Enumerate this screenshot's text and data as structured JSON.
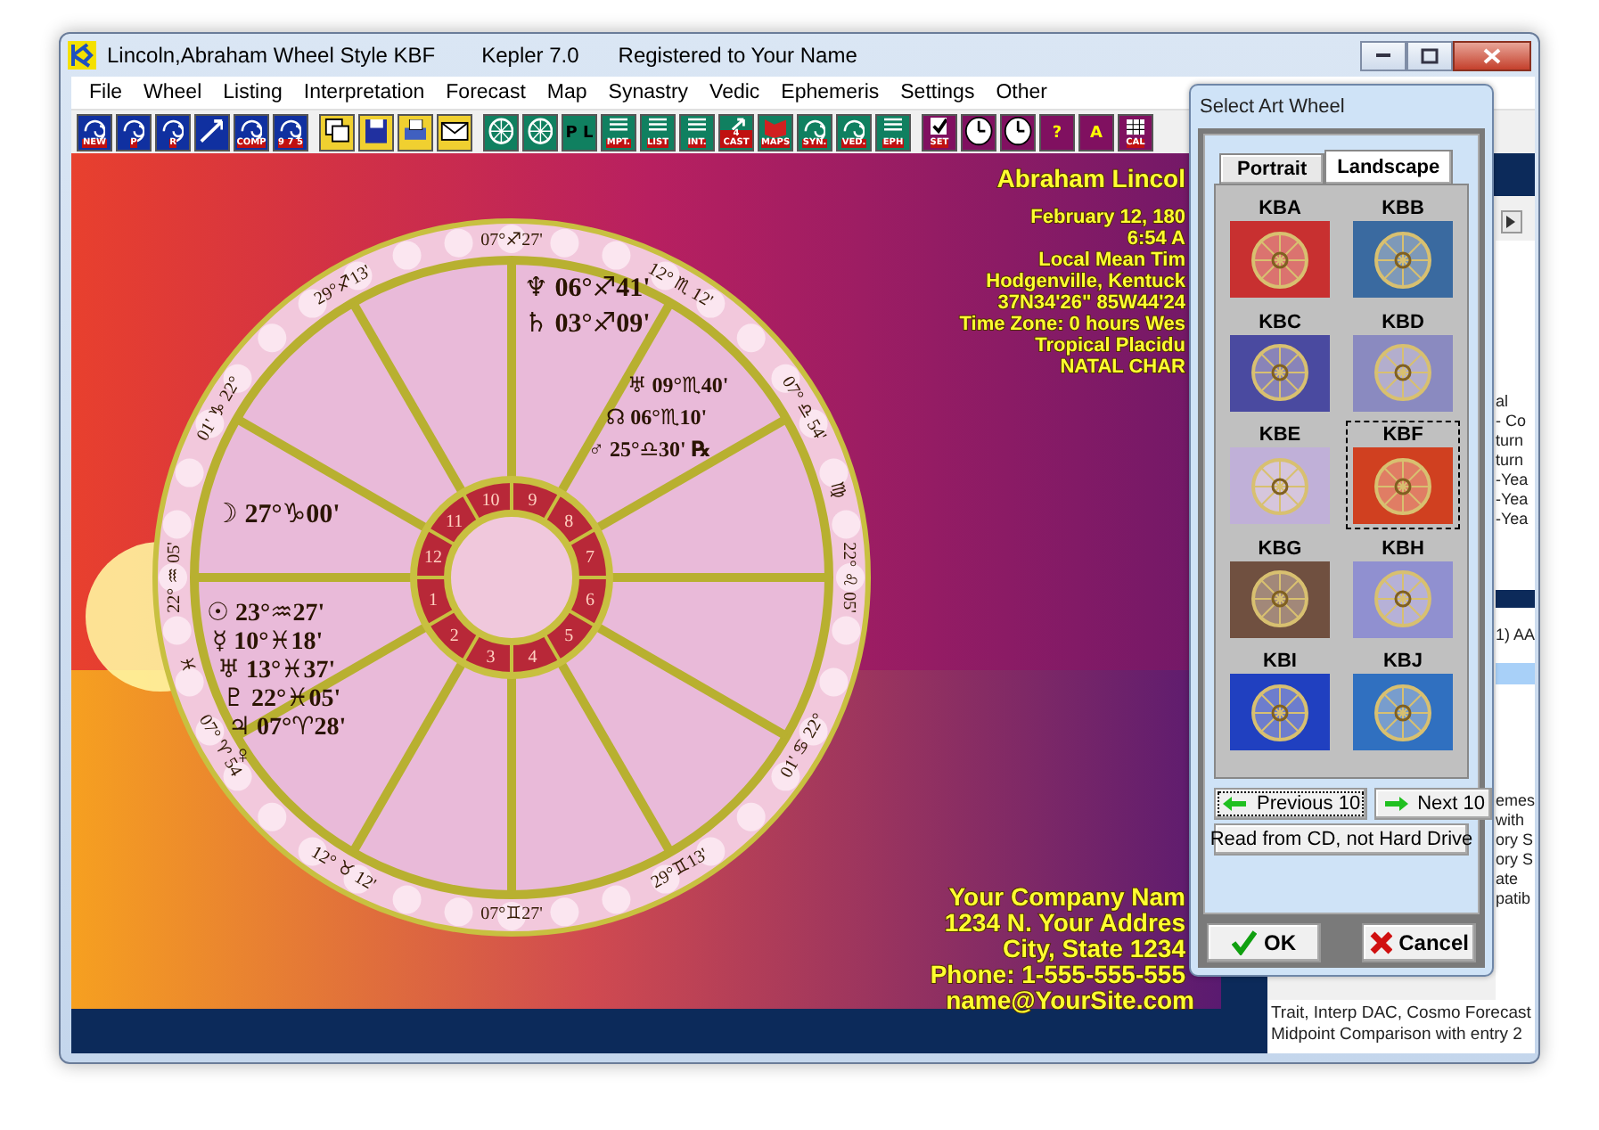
{
  "window": {
    "title": "Lincoln,Abraham Wheel Style KBF",
    "app": "Kepler 7.0",
    "registration": "Registered to Your Name"
  },
  "menu": [
    "File",
    "Wheel",
    "Listing",
    "Interpretation",
    "Forecast",
    "Map",
    "Synastry",
    "Vedic",
    "Ephemeris",
    "Settings",
    "Other"
  ],
  "toolbar": [
    {
      "kind": "chart",
      "items": [
        {
          "kind": "spiral",
          "label": "NEW"
        },
        {
          "kind": "spiral",
          "label": "P"
        },
        {
          "kind": "spiral",
          "label": "R"
        },
        {
          "kind": "arrow"
        },
        {
          "kind": "spiral",
          "label": "COMP"
        },
        {
          "kind": "spiral",
          "label": "9 7 5"
        }
      ]
    },
    {
      "kind": "file",
      "items": [
        {
          "kind": "windows"
        },
        {
          "kind": "disk"
        },
        {
          "kind": "printer"
        },
        {
          "kind": "envelope"
        }
      ]
    },
    {
      "kind": "report",
      "items": [
        {
          "kind": "wheel"
        },
        {
          "kind": "wheel"
        },
        {
          "kind": "plain",
          "label": "P L"
        },
        {
          "kind": "lines",
          "label": "MPT."
        },
        {
          "kind": "lines",
          "label": "LIST"
        },
        {
          "kind": "lines",
          "label": "INT."
        },
        {
          "kind": "smallarrow",
          "label": "4 CAST"
        },
        {
          "kind": "map",
          "label": "MAPS"
        },
        {
          "kind": "spiral",
          "label": "SYN."
        },
        {
          "kind": "spiral",
          "label": "VED."
        },
        {
          "kind": "lines",
          "label": "EPH"
        }
      ]
    },
    {
      "kind": "tool",
      "items": [
        {
          "kind": "check",
          "label": "SET"
        },
        {
          "kind": "clock"
        },
        {
          "kind": "clock"
        },
        {
          "kind": "plain",
          "label": "?"
        },
        {
          "kind": "plain",
          "label": "A"
        },
        {
          "kind": "grid",
          "label": "CAL"
        }
      ]
    }
  ],
  "chart": {
    "header": [
      "Abraham Lincol",
      "February 12, 180",
      "6:54 A",
      "Local Mean Tim",
      "Hodgenville, Kentuck",
      "37N34'26\"  85W44'24",
      "Time Zone: 0 hours Wes",
      "Tropical Placidu",
      "NATAL CHAR"
    ],
    "footer": [
      "Your Company Nam",
      "1234 N. Your Addres",
      "City, State 1234",
      "Phone: 1-555-555-555",
      "name@YourSite.com"
    ],
    "house_numbers": [
      "1",
      "2",
      "3",
      "4",
      "5",
      "6",
      "7",
      "8",
      "9",
      "10",
      "11",
      "12"
    ],
    "cusps": [
      "07°♐27'",
      "29°♐13'",
      "12° ♏ 12'",
      "01' ♑ 22°",
      "07° ♎ 54'",
      "22° ♒ 05'",
      "22° ♌ 05'",
      "07° ♈ 54",
      "01' ♋ 22°",
      "12° ♉ 12'",
      "29°♊13'",
      "07°♊27'"
    ],
    "intercepted": [
      "♍",
      "♓"
    ],
    "planet_groups": [
      {
        "items": [
          "♆ 06°♐41'",
          "♄ 03°♐09'"
        ]
      },
      {
        "items": [
          "♅ 09°♏40'",
          "☊ 06°♏10'",
          "♂ 25°♎30' ℞"
        ]
      },
      {
        "items": [
          "☽ 27°♑00'"
        ]
      },
      {
        "items": [
          "☉ 23°♒27'",
          "☿ 10°♓18'",
          "♅ 13°♓37'",
          "♇ 22°♓05'",
          "♃ 07°♈28'",
          "♀"
        ]
      }
    ]
  },
  "side_panel": {
    "groups": [
      {
        "lines": [
          "al",
          "- Co",
          "turn",
          "turn",
          "-Yea",
          "-Yea",
          "-Yea"
        ]
      },
      {
        "lines": [
          "1) AA"
        ]
      },
      {
        "lines": [
          "emes",
          "with",
          "ory S",
          "ory S",
          "ate",
          "patib"
        ]
      }
    ],
    "bottom_lines": [
      "Trait, Interp DAC, Cosmo Forecast",
      "Midpoint Comparison  with entry 2"
    ]
  },
  "dialog": {
    "title": "Select Art Wheel",
    "tabs": [
      {
        "label": "Portrait",
        "selected": false
      },
      {
        "label": "Landscape",
        "selected": true
      }
    ],
    "wheels": [
      {
        "label": "KBA",
        "color": "#c83030",
        "selected": false
      },
      {
        "label": "KBB",
        "color": "#3a6aa0",
        "selected": false
      },
      {
        "label": "KBC",
        "color": "#4a4aa0",
        "selected": false
      },
      {
        "label": "KBD",
        "color": "#8a8ac0",
        "selected": false
      },
      {
        "label": "KBE",
        "color": "#c0b0d8",
        "selected": false
      },
      {
        "label": "KBF",
        "color": "#d04020",
        "selected": true
      },
      {
        "label": "KBG",
        "color": "#705040",
        "selected": false
      },
      {
        "label": "KBH",
        "color": "#9090d0",
        "selected": false
      },
      {
        "label": "KBI",
        "color": "#2040c0",
        "selected": false
      },
      {
        "label": "KBJ",
        "color": "#3070c0",
        "selected": false
      }
    ],
    "nav_buttons": [
      {
        "kind": "previous",
        "label": "Previous 10",
        "focused": true
      },
      {
        "kind": "next",
        "label": "Next 10",
        "focused": false
      }
    ],
    "read_button": "Read from CD, not Hard Drive",
    "buttons": [
      {
        "kind": "ok",
        "label": "OK"
      },
      {
        "kind": "cancel",
        "label": "Cancel"
      }
    ]
  }
}
